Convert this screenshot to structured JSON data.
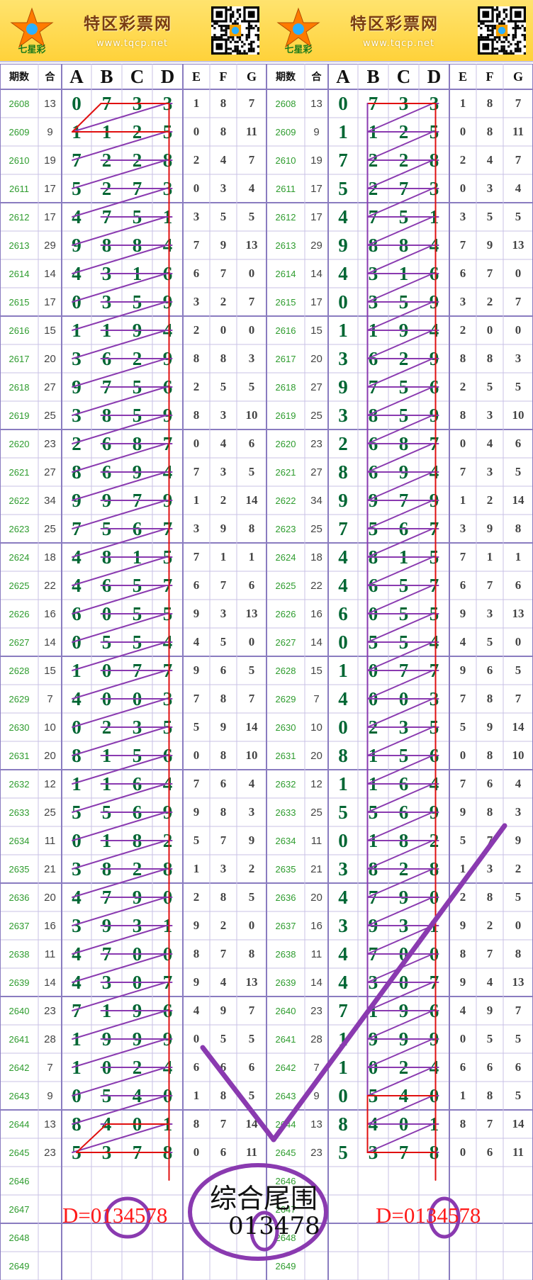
{
  "site": {
    "title": "特区彩票网",
    "url": "www.tqcp.net",
    "logo_text": "七星彩"
  },
  "table": {
    "headers": [
      "期数",
      "合",
      "A",
      "B",
      "C",
      "D",
      "E",
      "F",
      "G"
    ],
    "rows": [
      {
        "period": "2608",
        "sum": "13",
        "a": "0",
        "b": "7",
        "c": "3",
        "d": "3",
        "e": "1",
        "f": "8",
        "g": "7"
      },
      {
        "period": "2609",
        "sum": "9",
        "a": "1",
        "b": "1",
        "c": "2",
        "d": "5",
        "e": "0",
        "f": "8",
        "g": "11"
      },
      {
        "period": "2610",
        "sum": "19",
        "a": "7",
        "b": "2",
        "c": "2",
        "d": "8",
        "e": "2",
        "f": "4",
        "g": "7"
      },
      {
        "period": "2611",
        "sum": "17",
        "a": "5",
        "b": "2",
        "c": "7",
        "d": "3",
        "e": "0",
        "f": "3",
        "g": "4"
      },
      {
        "period": "2612",
        "sum": "17",
        "a": "4",
        "b": "7",
        "c": "5",
        "d": "1",
        "e": "3",
        "f": "5",
        "g": "5"
      },
      {
        "period": "2613",
        "sum": "29",
        "a": "9",
        "b": "8",
        "c": "8",
        "d": "4",
        "e": "7",
        "f": "9",
        "g": "13"
      },
      {
        "period": "2614",
        "sum": "14",
        "a": "4",
        "b": "3",
        "c": "1",
        "d": "6",
        "e": "6",
        "f": "7",
        "g": "0"
      },
      {
        "period": "2615",
        "sum": "17",
        "a": "0",
        "b": "3",
        "c": "5",
        "d": "9",
        "e": "3",
        "f": "2",
        "g": "7"
      },
      {
        "period": "2616",
        "sum": "15",
        "a": "1",
        "b": "1",
        "c": "9",
        "d": "4",
        "e": "2",
        "f": "0",
        "g": "0"
      },
      {
        "period": "2617",
        "sum": "20",
        "a": "3",
        "b": "6",
        "c": "2",
        "d": "9",
        "e": "8",
        "f": "8",
        "g": "3"
      },
      {
        "period": "2618",
        "sum": "27",
        "a": "9",
        "b": "7",
        "c": "5",
        "d": "6",
        "e": "2",
        "f": "5",
        "g": "5"
      },
      {
        "period": "2619",
        "sum": "25",
        "a": "3",
        "b": "8",
        "c": "5",
        "d": "9",
        "e": "8",
        "f": "3",
        "g": "10"
      },
      {
        "period": "2620",
        "sum": "23",
        "a": "2",
        "b": "6",
        "c": "8",
        "d": "7",
        "e": "0",
        "f": "4",
        "g": "6"
      },
      {
        "period": "2621",
        "sum": "27",
        "a": "8",
        "b": "6",
        "c": "9",
        "d": "4",
        "e": "7",
        "f": "3",
        "g": "5"
      },
      {
        "period": "2622",
        "sum": "34",
        "a": "9",
        "b": "9",
        "c": "7",
        "d": "9",
        "e": "1",
        "f": "2",
        "g": "14"
      },
      {
        "period": "2623",
        "sum": "25",
        "a": "7",
        "b": "5",
        "c": "6",
        "d": "7",
        "e": "3",
        "f": "9",
        "g": "8"
      },
      {
        "period": "2624",
        "sum": "18",
        "a": "4",
        "b": "8",
        "c": "1",
        "d": "5",
        "e": "7",
        "f": "1",
        "g": "1"
      },
      {
        "period": "2625",
        "sum": "22",
        "a": "4",
        "b": "6",
        "c": "5",
        "d": "7",
        "e": "6",
        "f": "7",
        "g": "6"
      },
      {
        "period": "2626",
        "sum": "16",
        "a": "6",
        "b": "0",
        "c": "5",
        "d": "5",
        "e": "9",
        "f": "3",
        "g": "13"
      },
      {
        "period": "2627",
        "sum": "14",
        "a": "0",
        "b": "5",
        "c": "5",
        "d": "4",
        "e": "4",
        "f": "5",
        "g": "0"
      },
      {
        "period": "2628",
        "sum": "15",
        "a": "1",
        "b": "0",
        "c": "7",
        "d": "7",
        "e": "9",
        "f": "6",
        "g": "5"
      },
      {
        "period": "2629",
        "sum": "7",
        "a": "4",
        "b": "0",
        "c": "0",
        "d": "3",
        "e": "7",
        "f": "8",
        "g": "7"
      },
      {
        "period": "2630",
        "sum": "10",
        "a": "0",
        "b": "2",
        "c": "3",
        "d": "5",
        "e": "5",
        "f": "9",
        "g": "14"
      },
      {
        "period": "2631",
        "sum": "20",
        "a": "8",
        "b": "1",
        "c": "5",
        "d": "6",
        "e": "0",
        "f": "8",
        "g": "10"
      },
      {
        "period": "2632",
        "sum": "12",
        "a": "1",
        "b": "1",
        "c": "6",
        "d": "4",
        "e": "7",
        "f": "6",
        "g": "4"
      },
      {
        "period": "2633",
        "sum": "25",
        "a": "5",
        "b": "5",
        "c": "6",
        "d": "9",
        "e": "9",
        "f": "8",
        "g": "3"
      },
      {
        "period": "2634",
        "sum": "11",
        "a": "0",
        "b": "1",
        "c": "8",
        "d": "2",
        "e": "5",
        "f": "7",
        "g": "9"
      },
      {
        "period": "2635",
        "sum": "21",
        "a": "3",
        "b": "8",
        "c": "2",
        "d": "8",
        "e": "1",
        "f": "3",
        "g": "2"
      },
      {
        "period": "2636",
        "sum": "20",
        "a": "4",
        "b": "7",
        "c": "9",
        "d": "0",
        "e": "2",
        "f": "8",
        "g": "5"
      },
      {
        "period": "2637",
        "sum": "16",
        "a": "3",
        "b": "9",
        "c": "3",
        "d": "1",
        "e": "9",
        "f": "2",
        "g": "0"
      },
      {
        "period": "2638",
        "sum": "11",
        "a": "4",
        "b": "7",
        "c": "0",
        "d": "0",
        "e": "8",
        "f": "7",
        "g": "8"
      },
      {
        "period": "2639",
        "sum": "14",
        "a": "4",
        "b": "3",
        "c": "0",
        "d": "7",
        "e": "9",
        "f": "4",
        "g": "13"
      },
      {
        "period": "2640",
        "sum": "23",
        "a": "7",
        "b": "1",
        "c": "9",
        "d": "6",
        "e": "4",
        "f": "9",
        "g": "7"
      },
      {
        "period": "2641",
        "sum": "28",
        "a": "1",
        "b": "9",
        "c": "9",
        "d": "9",
        "e": "0",
        "f": "5",
        "g": "5"
      },
      {
        "period": "2642",
        "sum": "7",
        "a": "1",
        "b": "0",
        "c": "2",
        "d": "4",
        "e": "6",
        "f": "6",
        "g": "6"
      },
      {
        "period": "2643",
        "sum": "9",
        "a": "0",
        "b": "5",
        "c": "4",
        "d": "0",
        "e": "1",
        "f": "8",
        "g": "5"
      },
      {
        "period": "2644",
        "sum": "13",
        "a": "8",
        "b": "4",
        "c": "0",
        "d": "1",
        "e": "8",
        "f": "7",
        "g": "14"
      },
      {
        "period": "2645",
        "sum": "23",
        "a": "5",
        "b": "3",
        "c": "7",
        "d": "8",
        "e": "0",
        "f": "6",
        "g": "11"
      },
      {
        "period": "2646",
        "sum": "",
        "a": "",
        "b": "",
        "c": "",
        "d": "",
        "e": "",
        "f": "",
        "g": ""
      },
      {
        "period": "2647",
        "sum": "",
        "a": "",
        "b": "",
        "c": "",
        "d": "",
        "e": "",
        "f": "",
        "g": ""
      },
      {
        "period": "2648",
        "sum": "",
        "a": "",
        "b": "",
        "c": "",
        "d": "",
        "e": "",
        "f": "",
        "g": ""
      },
      {
        "period": "2649",
        "sum": "",
        "a": "",
        "b": "",
        "c": "",
        "d": "",
        "e": "",
        "f": "",
        "g": ""
      }
    ]
  },
  "annotations": {
    "left_prediction": "D=0134578",
    "right_prediction": "D=0134578",
    "center_title": "综合尾围",
    "center_value": "013478"
  },
  "colors": {
    "banner": "#ffd23a",
    "grid_line": "#9a8cc8",
    "digit": "#006633",
    "period": "#2e9c2e",
    "red_line": "#e01010",
    "purple_line": "#8a3ab0",
    "prediction": "#ff1a1a"
  }
}
